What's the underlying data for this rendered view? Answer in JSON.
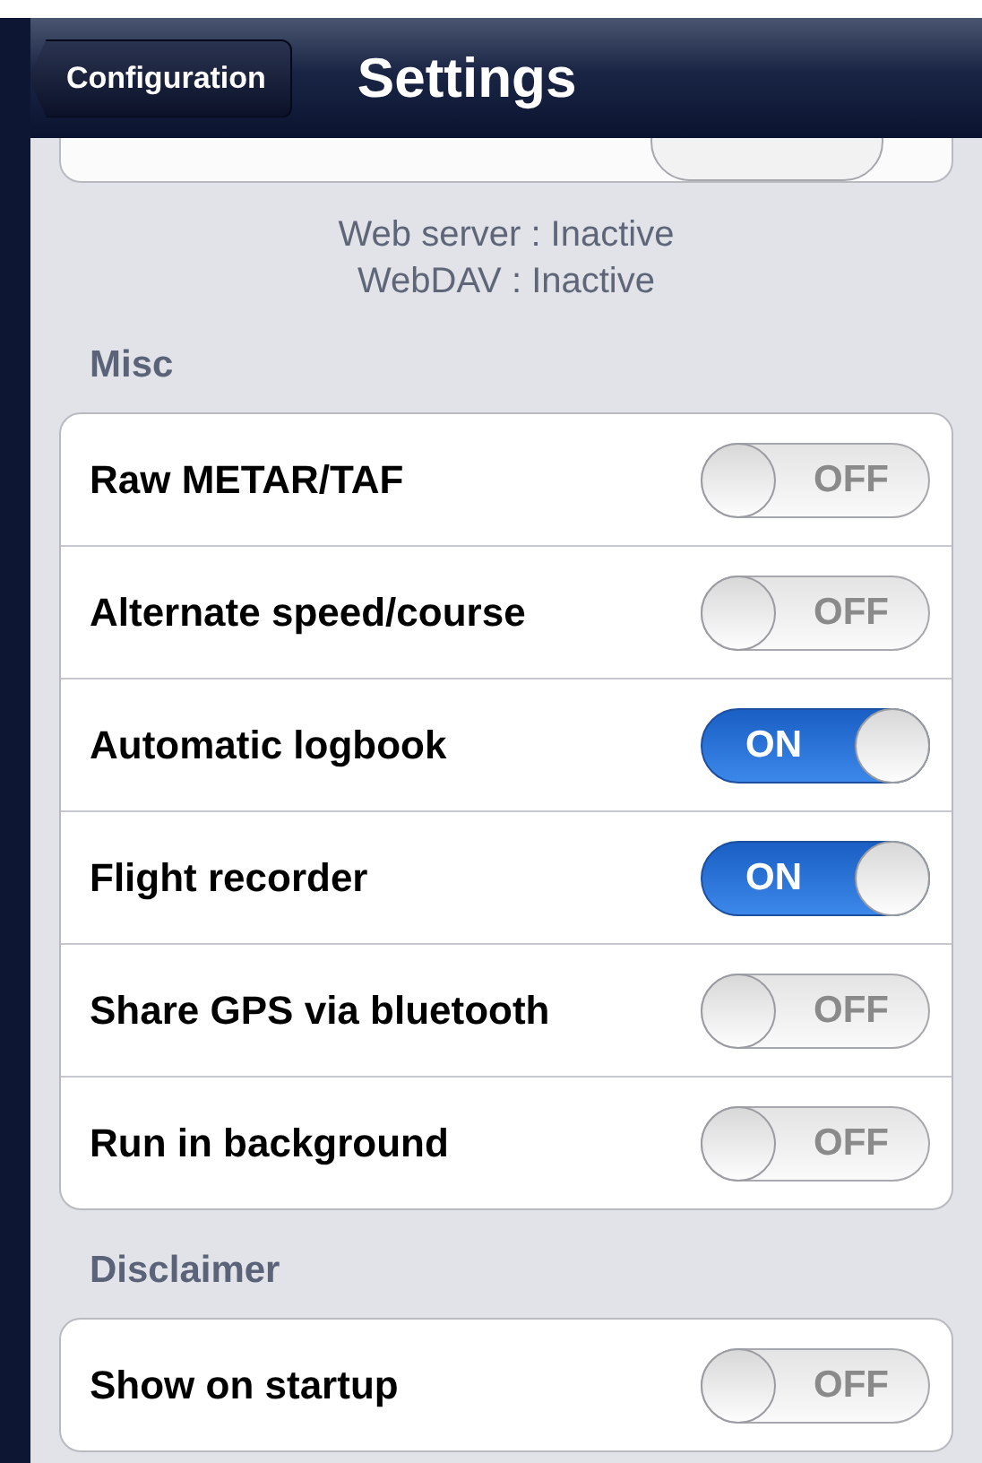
{
  "nav_bar": {
    "back_button": "Configuration",
    "title": "Settings"
  },
  "status_lines": [
    "Web server : Inactive",
    "WebDAV : Inactive"
  ],
  "sections": [
    {
      "header": "Misc",
      "rows": [
        {
          "label": "Raw METAR/TAF",
          "on": false,
          "switch_text": "OFF"
        },
        {
          "label": "Alternate speed/course",
          "on": false,
          "switch_text": "OFF"
        },
        {
          "label": "Automatic logbook",
          "on": true,
          "switch_text": "ON"
        },
        {
          "label": "Flight recorder",
          "on": true,
          "switch_text": "ON"
        },
        {
          "label": "Share GPS via bluetooth",
          "on": false,
          "switch_text": "OFF"
        },
        {
          "label": "Run in background",
          "on": false,
          "switch_text": "OFF"
        }
      ]
    },
    {
      "header": "Disclaimer",
      "rows": [
        {
          "label": "Show on startup",
          "on": false,
          "switch_text": "OFF"
        }
      ]
    }
  ]
}
